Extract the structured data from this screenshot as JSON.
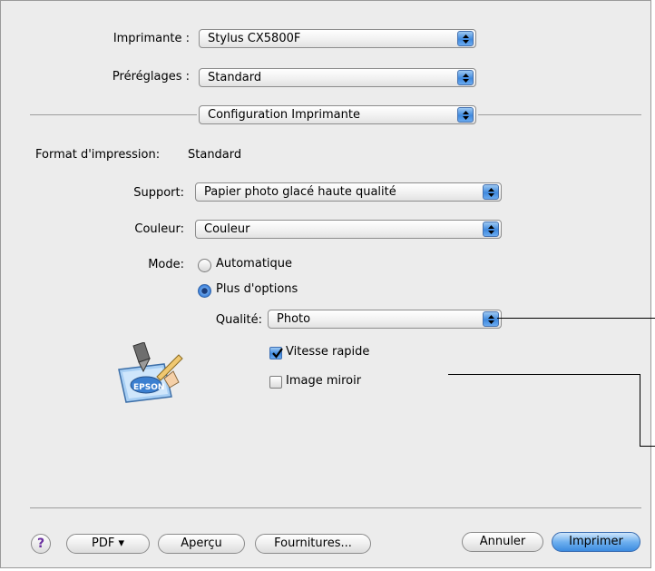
{
  "dialog": {
    "printer_label": "Imprimante :",
    "printer_value": "Stylus CX5800F",
    "presets_label": "Préréglages :",
    "presets_value": "Standard",
    "panel_value": "Configuration Imprimante",
    "format_label": "Format d'impression:",
    "format_value": "Standard",
    "support_label": "Support:",
    "support_value": "Papier photo glacé haute qualité",
    "color_label": "Couleur:",
    "color_value": "Couleur",
    "mode_label": "Mode:",
    "mode_auto": "Automatique",
    "mode_more": "Plus d'options",
    "quality_label": "Qualité:",
    "quality_value": "Photo",
    "fast_speed": "Vitesse rapide",
    "mirror_image": "Image miroir",
    "logo_text": "EPSON"
  },
  "state": {
    "mode_selected": "Plus d'options",
    "fast_speed_checked": true,
    "mirror_image_checked": false
  },
  "buttons": {
    "help": "?",
    "pdf": "PDF ▾",
    "preview": "Aperçu",
    "supplies": "Fournitures...",
    "cancel": "Annuler",
    "print": "Imprimer"
  },
  "icons": [
    "popup-arrows-icon",
    "epson-printer-icon",
    "check-mark-icon",
    "help-icon"
  ],
  "colors": {
    "accent": "#3f89de",
    "window": "#ececec",
    "help": "#6a2fa0"
  }
}
